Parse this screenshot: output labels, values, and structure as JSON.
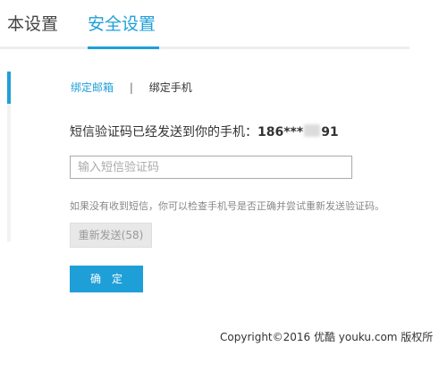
{
  "tabs": {
    "basic": "本设置",
    "security": "安全设置",
    "active_color": "#1f9fd8"
  },
  "subnav": {
    "email": "绑定邮箱",
    "separator": "|",
    "phone": "绑定手机"
  },
  "sms": {
    "sent_message": "短信验证码已经发送到你的手机：",
    "phone_prefix": "186***",
    "phone_suffix": "91"
  },
  "form": {
    "code_placeholder": "输入短信验证码",
    "code_value": "",
    "help_text": "如果没有收到短信，你可以检查手机号是否正确并尝试重新发送验证码。",
    "resend_label": "重新发送(58)",
    "confirm_label": "确定"
  },
  "footer": {
    "copyright": "Copyright©2016 优酷 youku.com 版权所"
  }
}
